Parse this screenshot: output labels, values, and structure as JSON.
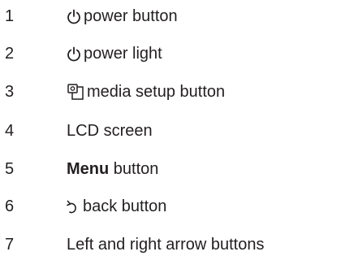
{
  "items": [
    {
      "number": "1",
      "label": "power button",
      "icon": "power-icon"
    },
    {
      "number": "2",
      "label": "power light",
      "icon": "power-icon"
    },
    {
      "number": "3",
      "label": "media setup button",
      "icon": "media-setup-icon"
    },
    {
      "number": "4",
      "label": "LCD screen"
    },
    {
      "number": "5",
      "label_bold": "Menu",
      "label": " button"
    },
    {
      "number": "6",
      "label": "back button",
      "icon": "back-arrow-icon"
    },
    {
      "number": "7",
      "label": "Left and right arrow buttons"
    }
  ]
}
